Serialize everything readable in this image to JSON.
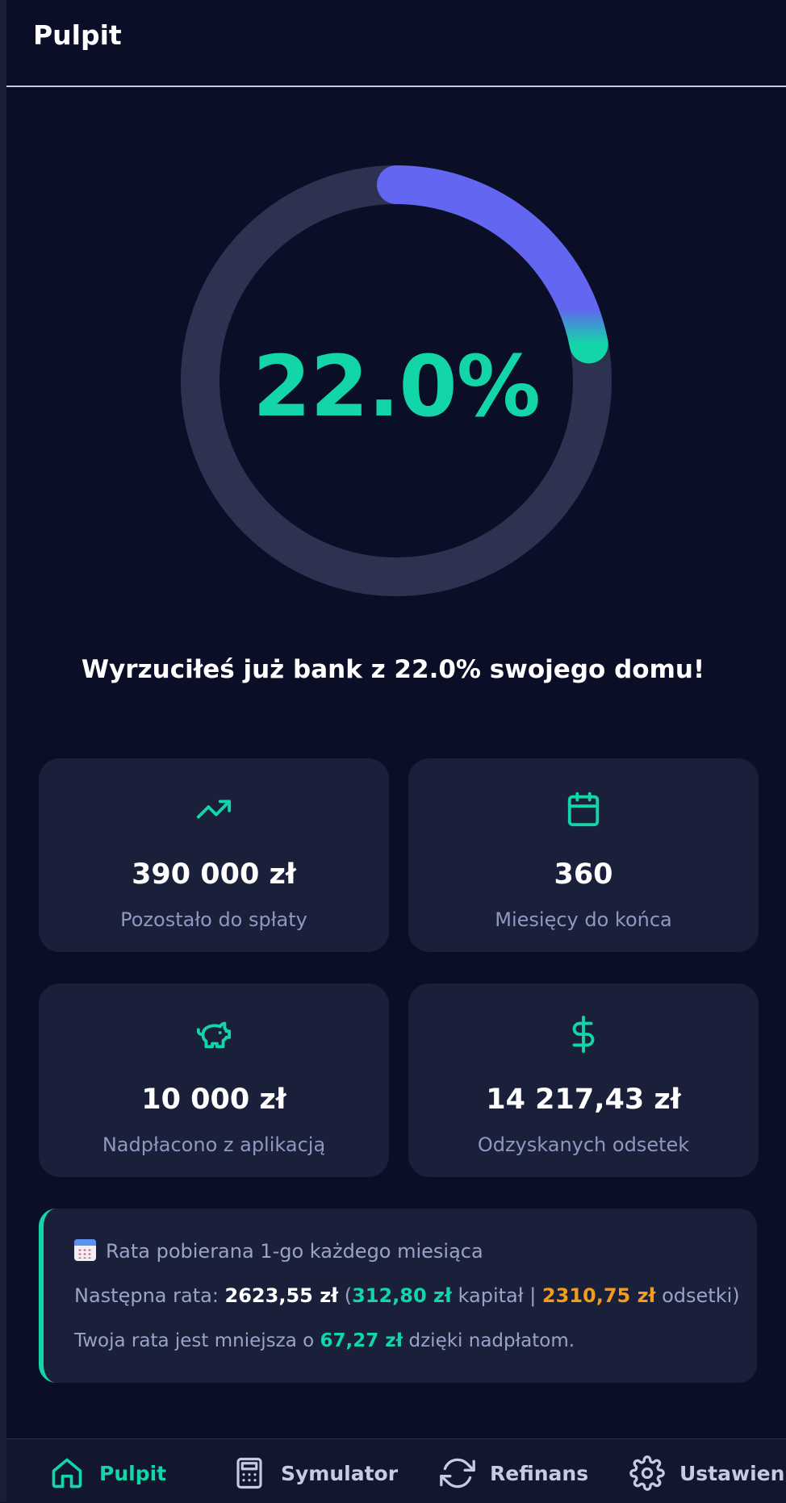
{
  "header": {
    "title": "Pulpit"
  },
  "progress": {
    "percent_label": "22.0%",
    "value": 0.22
  },
  "headline": "Wyrzuciłeś już bank z 22.0% swojego domu!",
  "cards": [
    {
      "icon": "trending-up-icon",
      "value": "390 000 zł",
      "label": "Pozostało do spłaty"
    },
    {
      "icon": "calendar-icon",
      "value": "360",
      "label": "Miesięcy do końca"
    },
    {
      "icon": "piggy-bank-icon",
      "value": "10 000 zł",
      "label": "Nadpłacono z aplikacją"
    },
    {
      "icon": "dollar-icon",
      "value": "14 217,43 zł",
      "label": "Odzyskanych odsetek"
    }
  ],
  "info": {
    "line1": "Rata pobierana 1-go każdego miesiąca",
    "next_prefix": "Następna rata: ",
    "next_amount": "2623,55 zł",
    "open_paren": " (",
    "capital_amount": "312,80 zł",
    "capital_label": " kapitał | ",
    "interest_amount": "2310,75 zł",
    "interest_label": " odsetki)",
    "savings_prefix": "Twoja rata jest mniejsza o ",
    "savings_amount": "67,27 zł",
    "savings_suffix": " dzięki nadpłatom."
  },
  "nav": [
    {
      "label": "Pulpit",
      "icon": "home-icon",
      "active": true
    },
    {
      "label": "Symulator",
      "icon": "calculator-icon",
      "active": false
    },
    {
      "label": "Refinans",
      "icon": "refresh-icon",
      "active": false
    },
    {
      "label": "Ustawienia",
      "icon": "gear-icon",
      "active": false
    }
  ],
  "colors": {
    "background": "#0a0e27",
    "card": "#1a1f3a",
    "accent_green": "#12d6a7",
    "accent_blue": "#6366f1",
    "accent_orange": "#f39c1b",
    "ring_track": "#2c3250"
  }
}
